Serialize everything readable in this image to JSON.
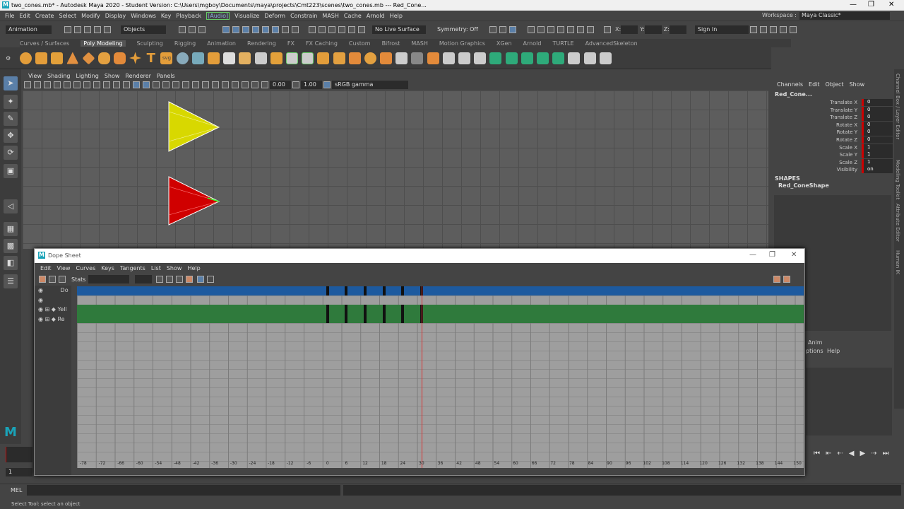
{
  "window": {
    "title": "two_cones.mb* - Autodesk Maya 2020 - Student Version: C:\\Users\\mgboy\\Documents\\maya\\projects\\Cmt223\\scenes\\two_cones.mb  ---  Red_Cone...",
    "logo": "M",
    "min": "—",
    "max": "❐",
    "close": "✕"
  },
  "menu": [
    "File",
    "Edit",
    "Create",
    "Select",
    "Modify",
    "Display",
    "Windows",
    "Key",
    "Playback",
    "Visualize",
    "Deform",
    "Constrain",
    "MASH",
    "Cache",
    "Arnold",
    "Help"
  ],
  "menu_audio": "[Audio]",
  "workspace": {
    "label": "Workspace :",
    "value": "Maya Classic*"
  },
  "status": {
    "mode": "Animation",
    "objects": "Objects",
    "live_surface": "No Live Surface",
    "symmetry": "Symmetry: Off",
    "x": "X:",
    "y": "Y:",
    "z": "Z:",
    "sign_in": "Sign In"
  },
  "shelf_tabs": [
    "Curves / Surfaces",
    "Poly Modeling",
    "Sculpting",
    "Rigging",
    "Animation",
    "Rendering",
    "FX",
    "FX Caching",
    "Custom",
    "Bifrost",
    "MASH",
    "Motion Graphics",
    "XGen",
    "Arnold",
    "TURTLE",
    "AdvancedSkeleton"
  ],
  "shelf_active": "Poly Modeling",
  "viewport": {
    "menu": [
      "View",
      "Shading",
      "Lighting",
      "Show",
      "Renderer",
      "Panels"
    ],
    "exposure": "0.00",
    "gamma": "1.00",
    "colorspace": "sRGB gamma"
  },
  "channelbox": {
    "menu": [
      "Channels",
      "Edit",
      "Object",
      "Show"
    ],
    "object": "Red_Cone...",
    "attrs": [
      {
        "name": "Translate X",
        "value": "0"
      },
      {
        "name": "Translate Y",
        "value": "0"
      },
      {
        "name": "Translate Z",
        "value": "0"
      },
      {
        "name": "Rotate X",
        "value": "0"
      },
      {
        "name": "Rotate Y",
        "value": "0"
      },
      {
        "name": "Rotate Z",
        "value": "0"
      },
      {
        "name": "Scale X",
        "value": "1"
      },
      {
        "name": "Scale Y",
        "value": "1"
      },
      {
        "name": "Scale Z",
        "value": "1"
      },
      {
        "name": "Visibility",
        "value": "on"
      }
    ],
    "shapes_label": "SHAPES",
    "shape": "Red_ConeShape"
  },
  "side_tabs": [
    "Channel Box / Layer Editor",
    "Modeling Toolkit",
    "Attribute Editor",
    "Human IK"
  ],
  "anim_layer": {
    "tab": "Anim",
    "options": "ptions",
    "help": "Help"
  },
  "dopesheet": {
    "title": "Dope Sheet",
    "menu": [
      "Edit",
      "View",
      "Curves",
      "Keys",
      "Tangents",
      "List",
      "Show",
      "Help"
    ],
    "stats": "Stats",
    "outliner": [
      "Do",
      "",
      "Yell",
      "Re"
    ],
    "keys": [
      0,
      6,
      12,
      18,
      24,
      30
    ],
    "current_frame": 30,
    "ticks": [
      "-78",
      "-72",
      "-66",
      "-60",
      "-54",
      "-48",
      "-42",
      "-36",
      "-30",
      "-24",
      "-18",
      "-12",
      "-6",
      "0",
      "6",
      "12",
      "18",
      "24",
      "30",
      "36",
      "42",
      "48",
      "54",
      "60",
      "66",
      "72",
      "78",
      "84",
      "90",
      "96",
      "102",
      "108",
      "114",
      "120",
      "126",
      "132",
      "138",
      "144",
      "150"
    ]
  },
  "timeline": {
    "frame": "1"
  },
  "cmd": {
    "label": "MEL"
  },
  "help": "Select Tool: select an object"
}
